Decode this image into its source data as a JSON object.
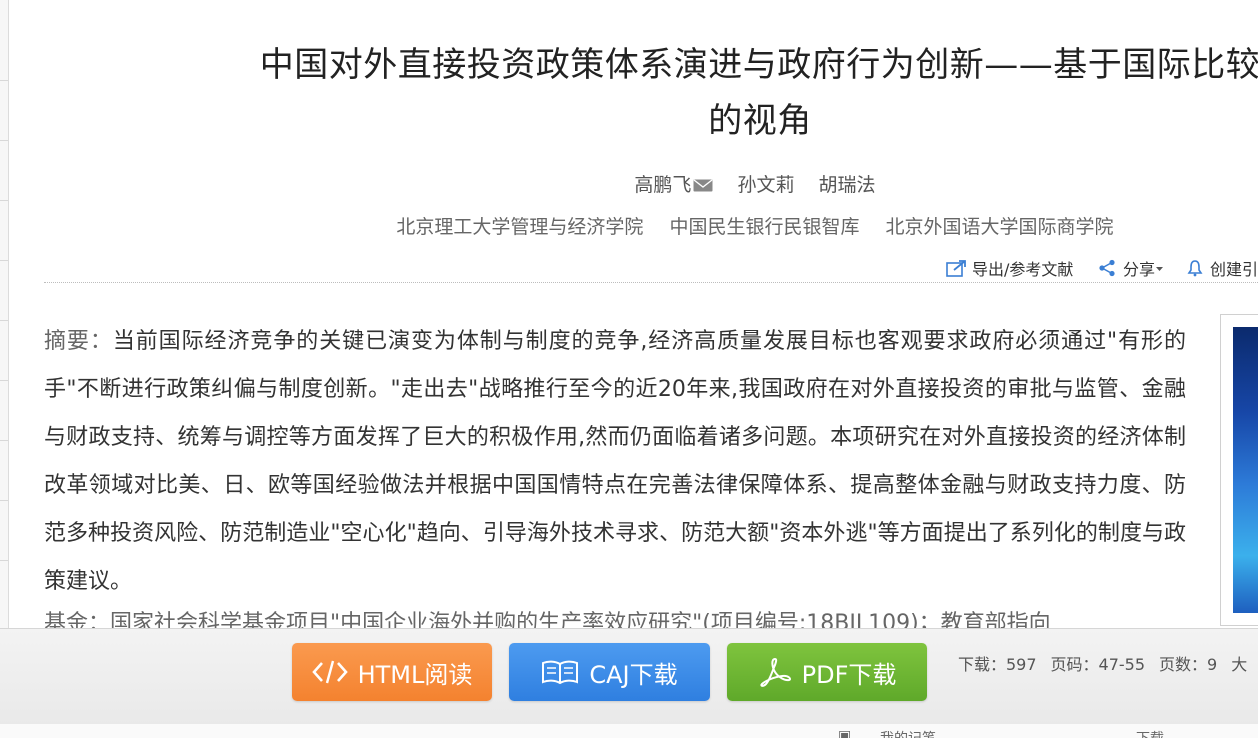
{
  "article": {
    "title_line1": "中国对外直接投资政策体系演进与政府行为创新——基于国际比较",
    "title_line2": "的视角",
    "authors": [
      "高鹏飞",
      "孙文莉",
      "胡瑞法"
    ],
    "organizations": [
      "北京理工大学管理与经济学院",
      "中国民生银行民银智库",
      "北京外国语大学国际商学院"
    ]
  },
  "toolbar": {
    "export_label": "导出/参考文献",
    "share_label": "分享",
    "create_label": "创建引"
  },
  "abstract": {
    "label": "摘要：",
    "text": "当前国际经济竞争的关键已演变为体制与制度的竞争,经济高质量发展目标也客观要求政府必须通过\"有形的手\"不断进行政策纠偏与制度创新。\"走出去\"战略推行至今的近20年来,我国政府在对外直接投资的审批与监管、金融与财政支持、统筹与调控等方面发挥了巨大的积极作用,然而仍面临着诸多问题。本项研究在对外直接投资的经济体制改革领域对比美、日、欧等国经验做法并根据中国国情特点在完善法律保障体系、提高整体金融与财政支持力度、防范多种投资风险、防范制造业\"空心化\"趋向、引导海外技术寻求、防范大额\"资本外逃\"等方面提出了系列化的制度与政策建议。"
  },
  "fund": {
    "label": "基金：",
    "text": "国家社会科学基金项目\"中国企业海外并购的生产率效应研究\"(项目编号:18BJL109)；教育部指向"
  },
  "download": {
    "html_label": "HTML阅读",
    "caj_label": "CAJ下载",
    "pdf_label": "PDF下载"
  },
  "stats": {
    "downloads": "下载：597",
    "pages_range": "页码：47-55",
    "page_count": "页数：9",
    "size_prefix": "大"
  },
  "footer": {
    "my_notes": "我的记笔",
    "download": "下载"
  },
  "colors": {
    "html_button": "#f4822f",
    "caj_button": "#2f7fe0",
    "pdf_button": "#5fa92a"
  }
}
